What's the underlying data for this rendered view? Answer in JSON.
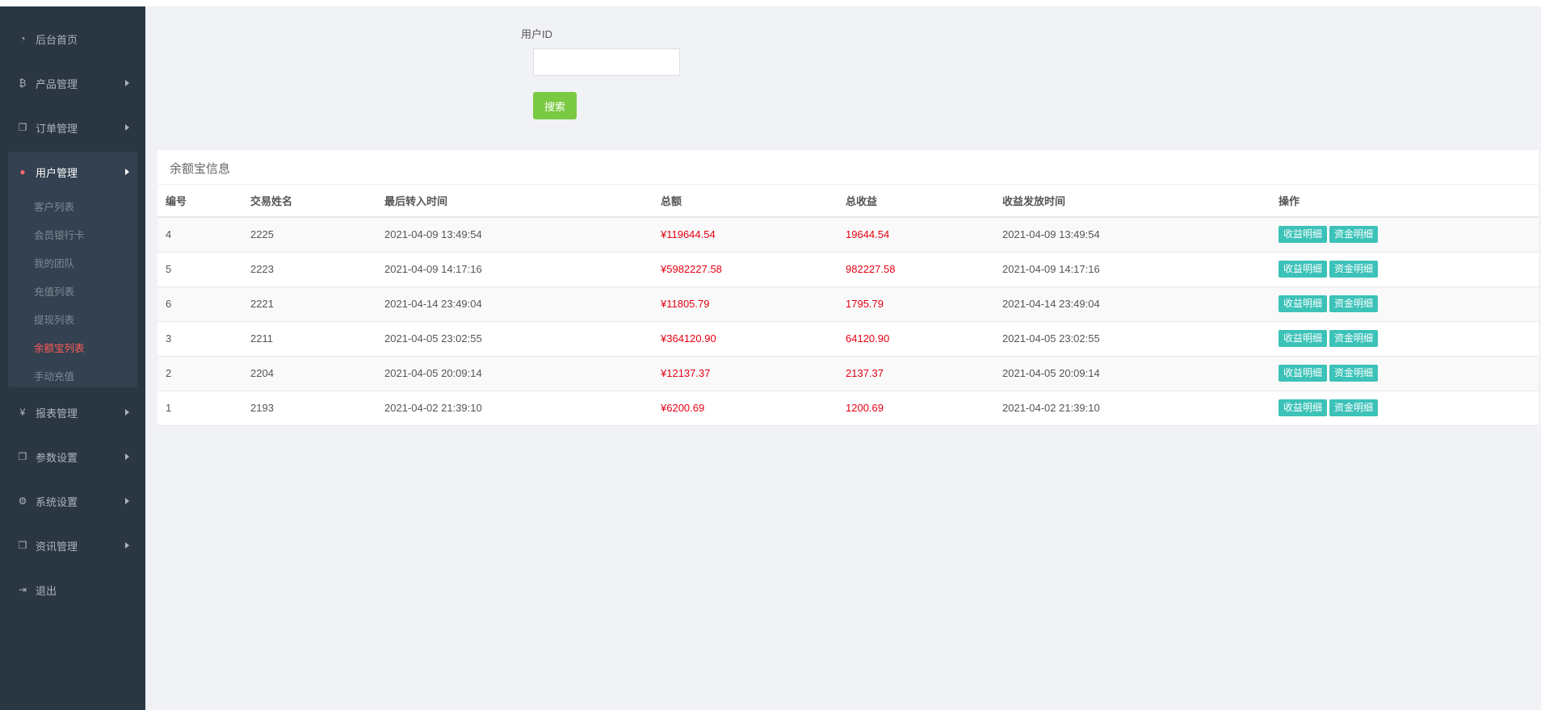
{
  "sidebar": {
    "items": [
      {
        "label": "后台首页",
        "icon": "dashboard-icon"
      },
      {
        "label": "产品管理",
        "icon": "bitcoin-icon"
      },
      {
        "label": "订单管理",
        "icon": "copy-icon"
      },
      {
        "label": "用户管理",
        "icon": "user-icon"
      },
      {
        "label": "报表管理",
        "icon": "yen-icon"
      },
      {
        "label": "参数设置",
        "icon": "copy-icon"
      },
      {
        "label": "系统设置",
        "icon": "gears-icon"
      },
      {
        "label": "资讯管理",
        "icon": "copy-icon"
      },
      {
        "label": "退出",
        "icon": "sign-out-icon"
      }
    ],
    "submenu": [
      {
        "label": "客户列表"
      },
      {
        "label": "会员银行卡"
      },
      {
        "label": "我的团队"
      },
      {
        "label": "充值列表"
      },
      {
        "label": "提现列表"
      },
      {
        "label": "余额宝列表"
      },
      {
        "label": "手动充值"
      }
    ],
    "icon_glyphs": {
      "dashboard": "◔",
      "bitcoin": "₿",
      "copy": "❐",
      "user": "●",
      "yen": "¥",
      "gears": "⚙",
      "signout": "⇥"
    }
  },
  "search": {
    "label": "用户ID",
    "value": "",
    "button": "搜索"
  },
  "panel": {
    "title": "余额宝信息",
    "columns": [
      "编号",
      "交易姓名",
      "最后转入时间",
      "总额",
      "总收益",
      "收益发放时间",
      "操作"
    ],
    "rows": [
      {
        "id": "4",
        "name": "2225",
        "last_in": "2021-04-09 13:49:54",
        "total": "¥119644.54",
        "profit": "19644.54",
        "payout": "2021-04-09 13:49:54"
      },
      {
        "id": "5",
        "name": "2223",
        "last_in": "2021-04-09 14:17:16",
        "total": "¥5982227.58",
        "profit": "982227.58",
        "payout": "2021-04-09 14:17:16"
      },
      {
        "id": "6",
        "name": "2221",
        "last_in": "2021-04-14 23:49:04",
        "total": "¥11805.79",
        "profit": "1795.79",
        "payout": "2021-04-14 23:49:04"
      },
      {
        "id": "3",
        "name": "2211",
        "last_in": "2021-04-05 23:02:55",
        "total": "¥364120.90",
        "profit": "64120.90",
        "payout": "2021-04-05 23:02:55"
      },
      {
        "id": "2",
        "name": "2204",
        "last_in": "2021-04-05 20:09:14",
        "total": "¥12137.37",
        "profit": "2137.37",
        "payout": "2021-04-05 20:09:14"
      },
      {
        "id": "1",
        "name": "2193",
        "last_in": "2021-04-02 21:39:10",
        "total": "¥6200.69",
        "profit": "1200.69",
        "payout": "2021-04-02 21:39:10"
      }
    ],
    "actions": {
      "profit_detail": "收益明细",
      "fund_detail": "资金明细"
    }
  },
  "colors": {
    "sidebar_bg": "#2a3642",
    "accent_red": "#e60012",
    "search_green": "#7ac943",
    "action_teal": "#3cc2b8"
  }
}
